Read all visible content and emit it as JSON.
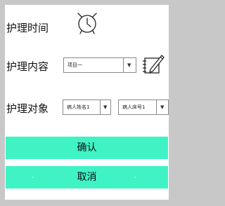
{
  "form": {
    "time_label": "护理时间",
    "content_label": "护理内容",
    "target_label": "护理对象",
    "content_select": {
      "selected": "项目一"
    },
    "patient_name_select": {
      "selected": "病人姓名1"
    },
    "bed_number_select": {
      "selected": "病人床号1"
    }
  },
  "actions": {
    "confirm_label": "确认",
    "cancel_label": "取消"
  },
  "colors": {
    "button_bg": "#3ff3c5",
    "frame_bg": "#c8c8c8"
  },
  "icons": {
    "time": "alarm-clock-icon",
    "content_edit": "edit-note-icon",
    "dropdown": "triangle-down"
  }
}
